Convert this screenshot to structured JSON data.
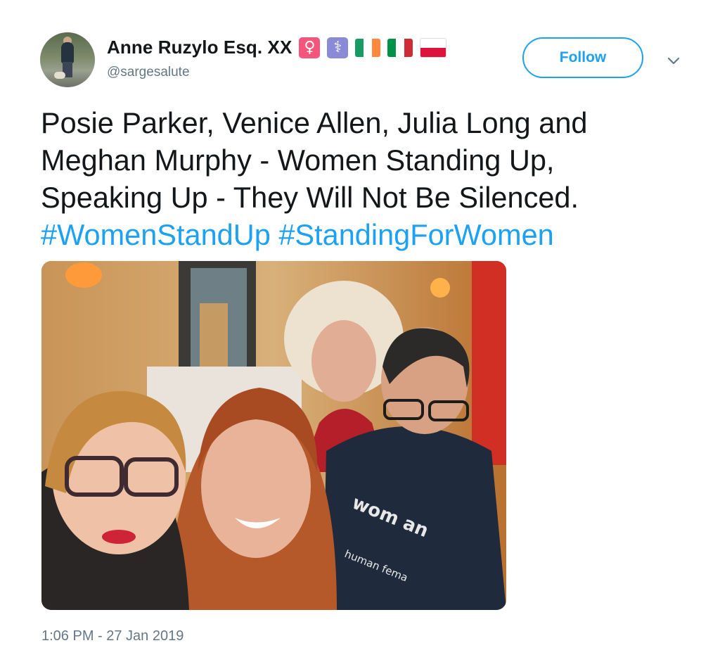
{
  "user": {
    "display_name": "Anne Ruzylo Esq. XX",
    "handle": "@sargesalute",
    "badges": [
      "female-sign-icon",
      "medical-staff-icon",
      "ireland-flag-icon",
      "italy-flag-icon",
      "poland-flag-icon"
    ]
  },
  "follow_button": {
    "label": "Follow"
  },
  "tweet": {
    "text_lines": [
      "Posie Parker, Venice Allen, Julia Long and",
      "Meghan Murphy - Women Standing Up,",
      "Speaking Up - They Will Not Be Silenced."
    ],
    "hashtags": "#WomenStandUp #StandingForWomen"
  },
  "media": {
    "shirt_text": [
      "wom an",
      "human fema"
    ]
  },
  "timestamp": "1:06 PM - 27 Jan 2019",
  "colors": {
    "accent": "#1da1f2",
    "secondary_text": "#657786",
    "primary_text": "#14171a"
  }
}
